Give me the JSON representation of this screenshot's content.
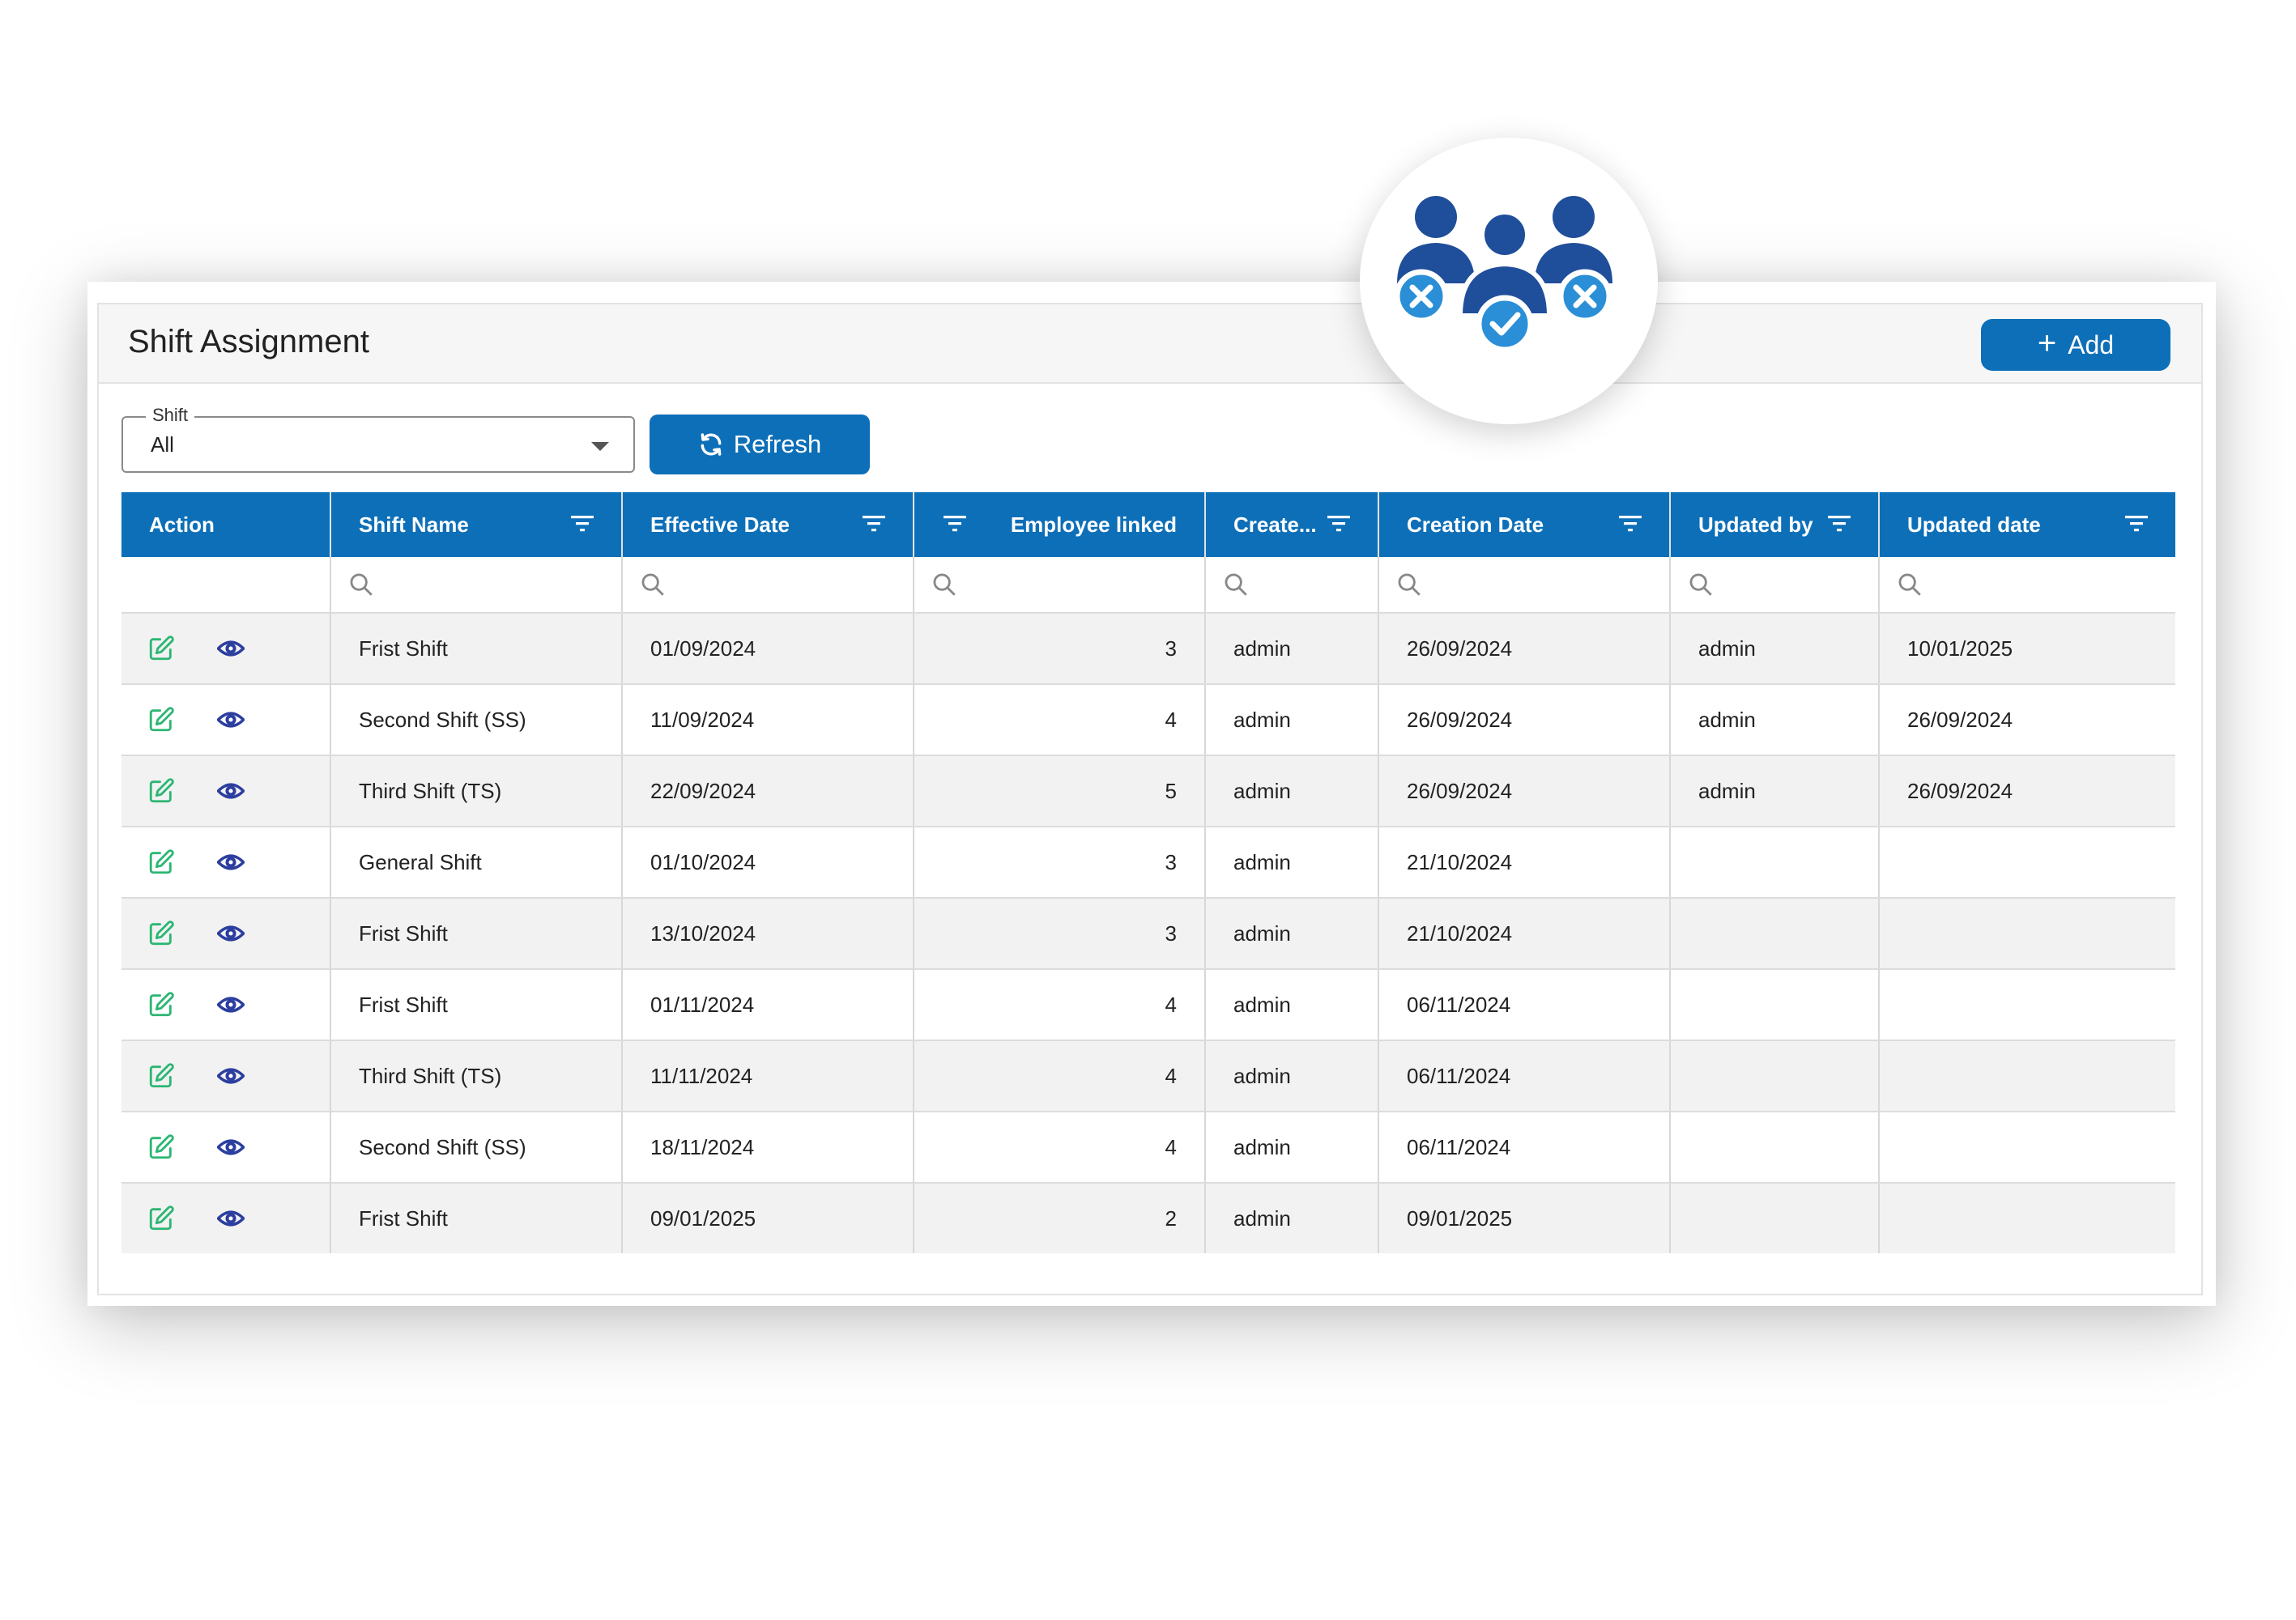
{
  "page": {
    "title": "Shift Assignment"
  },
  "toolbar": {
    "add_label": "Add",
    "shift_filter": {
      "label": "Shift",
      "value": "All"
    },
    "refresh_label": "Refresh"
  },
  "table": {
    "columns": [
      "Action",
      "Shift Name",
      "Effective Date",
      "Employee linked",
      "Create...",
      "Creation Date",
      "Updated by",
      "Updated date"
    ],
    "rows": [
      {
        "shift_name": "Frist Shift",
        "effective_date": "01/09/2024",
        "employee_linked": "3",
        "created_by": "admin",
        "creation_date": "26/09/2024",
        "updated_by": "admin",
        "updated_date": "10/01/2025"
      },
      {
        "shift_name": "Second Shift (SS)",
        "effective_date": "11/09/2024",
        "employee_linked": "4",
        "created_by": "admin",
        "creation_date": "26/09/2024",
        "updated_by": "admin",
        "updated_date": "26/09/2024"
      },
      {
        "shift_name": "Third Shift (TS)",
        "effective_date": "22/09/2024",
        "employee_linked": "5",
        "created_by": "admin",
        "creation_date": "26/09/2024",
        "updated_by": "admin",
        "updated_date": "26/09/2024"
      },
      {
        "shift_name": "General Shift",
        "effective_date": "01/10/2024",
        "employee_linked": "3",
        "created_by": "admin",
        "creation_date": "21/10/2024",
        "updated_by": "",
        "updated_date": ""
      },
      {
        "shift_name": "Frist Shift",
        "effective_date": "13/10/2024",
        "employee_linked": "3",
        "created_by": "admin",
        "creation_date": "21/10/2024",
        "updated_by": "",
        "updated_date": ""
      },
      {
        "shift_name": "Frist Shift",
        "effective_date": "01/11/2024",
        "employee_linked": "4",
        "created_by": "admin",
        "creation_date": "06/11/2024",
        "updated_by": "",
        "updated_date": ""
      },
      {
        "shift_name": "Third Shift (TS)",
        "effective_date": "11/11/2024",
        "employee_linked": "4",
        "created_by": "admin",
        "creation_date": "06/11/2024",
        "updated_by": "",
        "updated_date": ""
      },
      {
        "shift_name": "Second Shift (SS)",
        "effective_date": "18/11/2024",
        "employee_linked": "4",
        "created_by": "admin",
        "creation_date": "06/11/2024",
        "updated_by": "",
        "updated_date": ""
      },
      {
        "shift_name": "Frist Shift",
        "effective_date": "09/01/2025",
        "employee_linked": "2",
        "created_by": "admin",
        "creation_date": "09/01/2025",
        "updated_by": "",
        "updated_date": ""
      }
    ]
  },
  "icons": {
    "edit": "edit-icon",
    "view": "eye-icon",
    "filter": "filter-icon",
    "search": "search-icon",
    "refresh": "refresh-icon",
    "badge": "team-assignment-icon"
  },
  "colors": {
    "primary": "#0d6fb8",
    "edit_icon": "#2bb673",
    "view_icon": "#2c3e9e",
    "badge_people": "#1f4e9a",
    "badge_status": "#2a8fd6"
  }
}
